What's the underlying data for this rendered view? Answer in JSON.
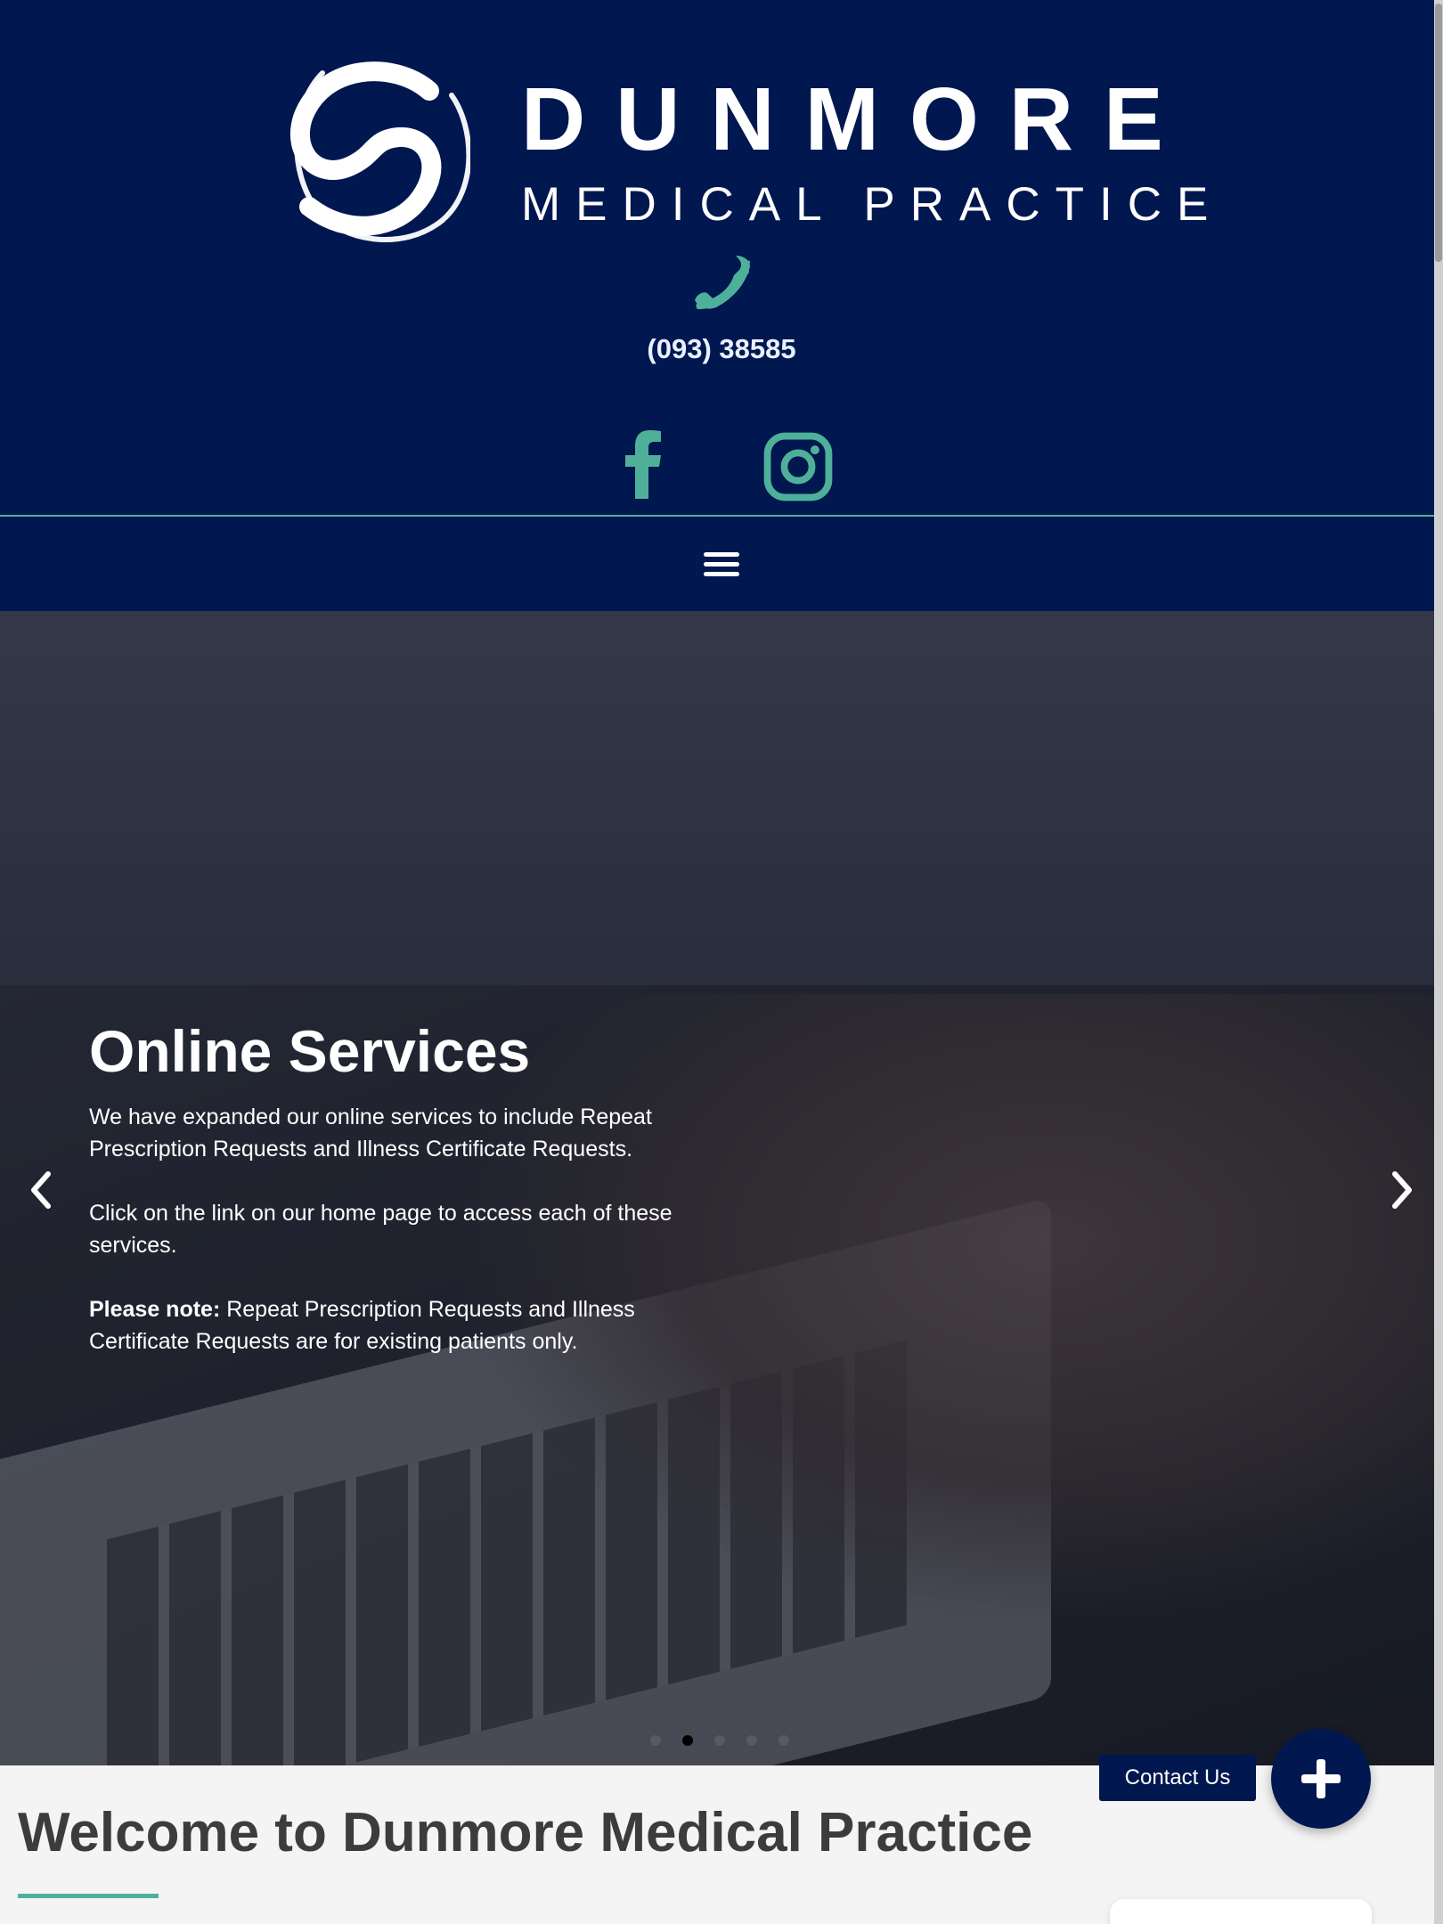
{
  "brand": {
    "name": "DUNMORE",
    "subtitle": "MEDICAL PRACTICE",
    "logo_icon": "swirl-logo-icon",
    "color_navy": "#011750",
    "color_accent": "#4fb09a"
  },
  "contact": {
    "phone": "(093) 38585",
    "phone_icon": "phone-icon"
  },
  "social": [
    {
      "name": "Facebook",
      "icon": "facebook-icon"
    },
    {
      "name": "Instagram",
      "icon": "instagram-icon"
    }
  ],
  "nav": {
    "menu_icon": "hamburger-menu-icon"
  },
  "hero": {
    "title": "Online Services",
    "paragraph1": "We have expanded our online services to include Repeat Prescription Requests and Illness Certificate Requests.",
    "paragraph2": "Click on the link on our home page to access each of these services.",
    "note_label": "Please note:",
    "note_text": " Repeat Prescription Requests and Illness Certificate Requests are for existing patients only.",
    "slide_count": 5,
    "active_slide": 2
  },
  "welcome": {
    "title": "Welcome to Dunmore Medical Practice"
  },
  "floating": {
    "contact_label": "Contact Us",
    "fab_icon": "plus-icon"
  }
}
